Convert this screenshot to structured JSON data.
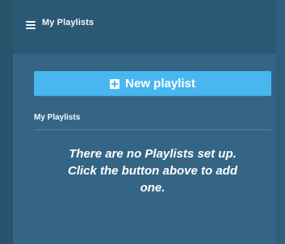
{
  "header": {
    "title": "My Playlists",
    "icon": "list-icon"
  },
  "actions": {
    "new_playlist_label": "New playlist",
    "new_playlist_icon": "plus-square-icon"
  },
  "playlists": {
    "section_title": "My Playlists",
    "empty_message": "There are no Playlists set up.\nClick the button above to add\none."
  },
  "colors": {
    "panel_background": "#356787",
    "header_background": "#2b5975",
    "button_background": "#49b7ef",
    "text": "#ffffff"
  }
}
